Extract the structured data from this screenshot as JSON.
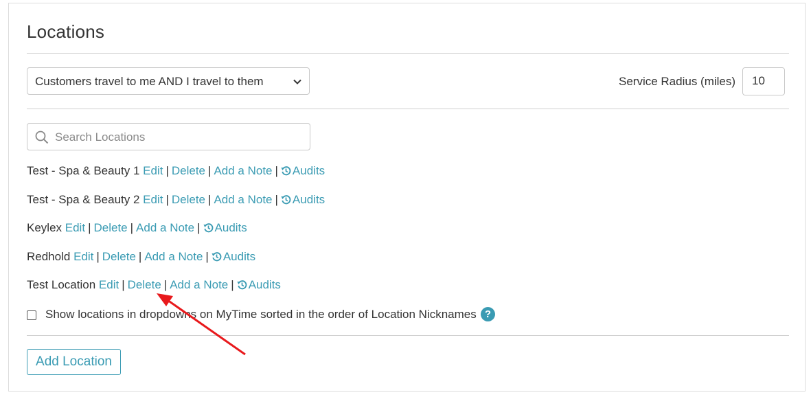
{
  "page_title": "Locations",
  "travel_select": {
    "value": "Customers travel to me AND I travel to them"
  },
  "service_radius": {
    "label": "Service Radius (miles)",
    "value": "10"
  },
  "search": {
    "placeholder": "Search Locations"
  },
  "actions": {
    "edit": "Edit",
    "delete": "Delete",
    "add_note": "Add a Note",
    "audits": "Audits",
    "separator": "|"
  },
  "locations": [
    {
      "name": "Test - Spa & Beauty 1"
    },
    {
      "name": "Test - Spa & Beauty 2"
    },
    {
      "name": "Keylex"
    },
    {
      "name": "Redhold"
    },
    {
      "name": "Test Location"
    }
  ],
  "sort_option": {
    "label": "Show locations in dropdowns on MyTime sorted in the order of Location Nicknames",
    "checked": false,
    "help": "?"
  },
  "add_button": {
    "label": "Add Location"
  },
  "colors": {
    "link": "#3a9bb3",
    "text": "#333333",
    "arrow": "#e8191c"
  }
}
